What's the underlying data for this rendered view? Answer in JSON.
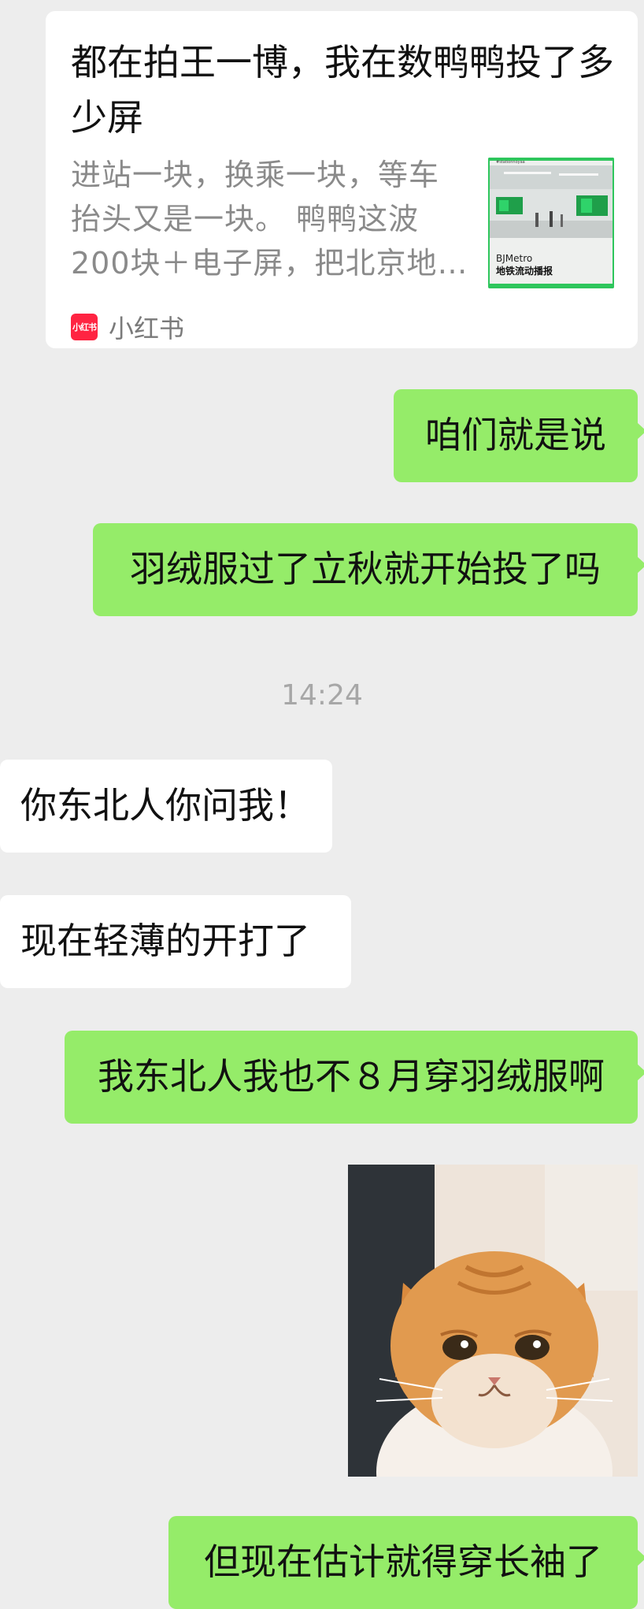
{
  "link_card": {
    "title": "都在拍王一博，我在数鸭鸭投了多少屏",
    "description_lines": [
      "进站一块，换乘一块，等车",
      "抬头又是一块。 鸭鸭这波",
      "200块＋电子屏，把北京地…"
    ],
    "thumbnail": {
      "caption_top": "#stationnoyaa",
      "brand": "BJMetro",
      "subtitle": "地铁流动播报"
    },
    "source_logo_text": "小红书",
    "source_name": "小红书",
    "brand_color": "#ff2442"
  },
  "messages": {
    "m1": "咱们就是说",
    "m2": "羽绒服过了立秋就开始投了吗",
    "timestamp": "14:24",
    "m3": "你东北人你问我！",
    "m4": "现在轻薄的开打了",
    "m5": "我东北人我也不８月穿羽绒服啊",
    "m6": "但现在估计就得穿长袖了"
  },
  "sticker": {
    "icon": "crying-cat-sticker"
  },
  "colors": {
    "background": "#ededed",
    "sent_bubble": "#95ec69",
    "received_bubble": "#ffffff",
    "timestamp_text": "#a7a7a7"
  }
}
